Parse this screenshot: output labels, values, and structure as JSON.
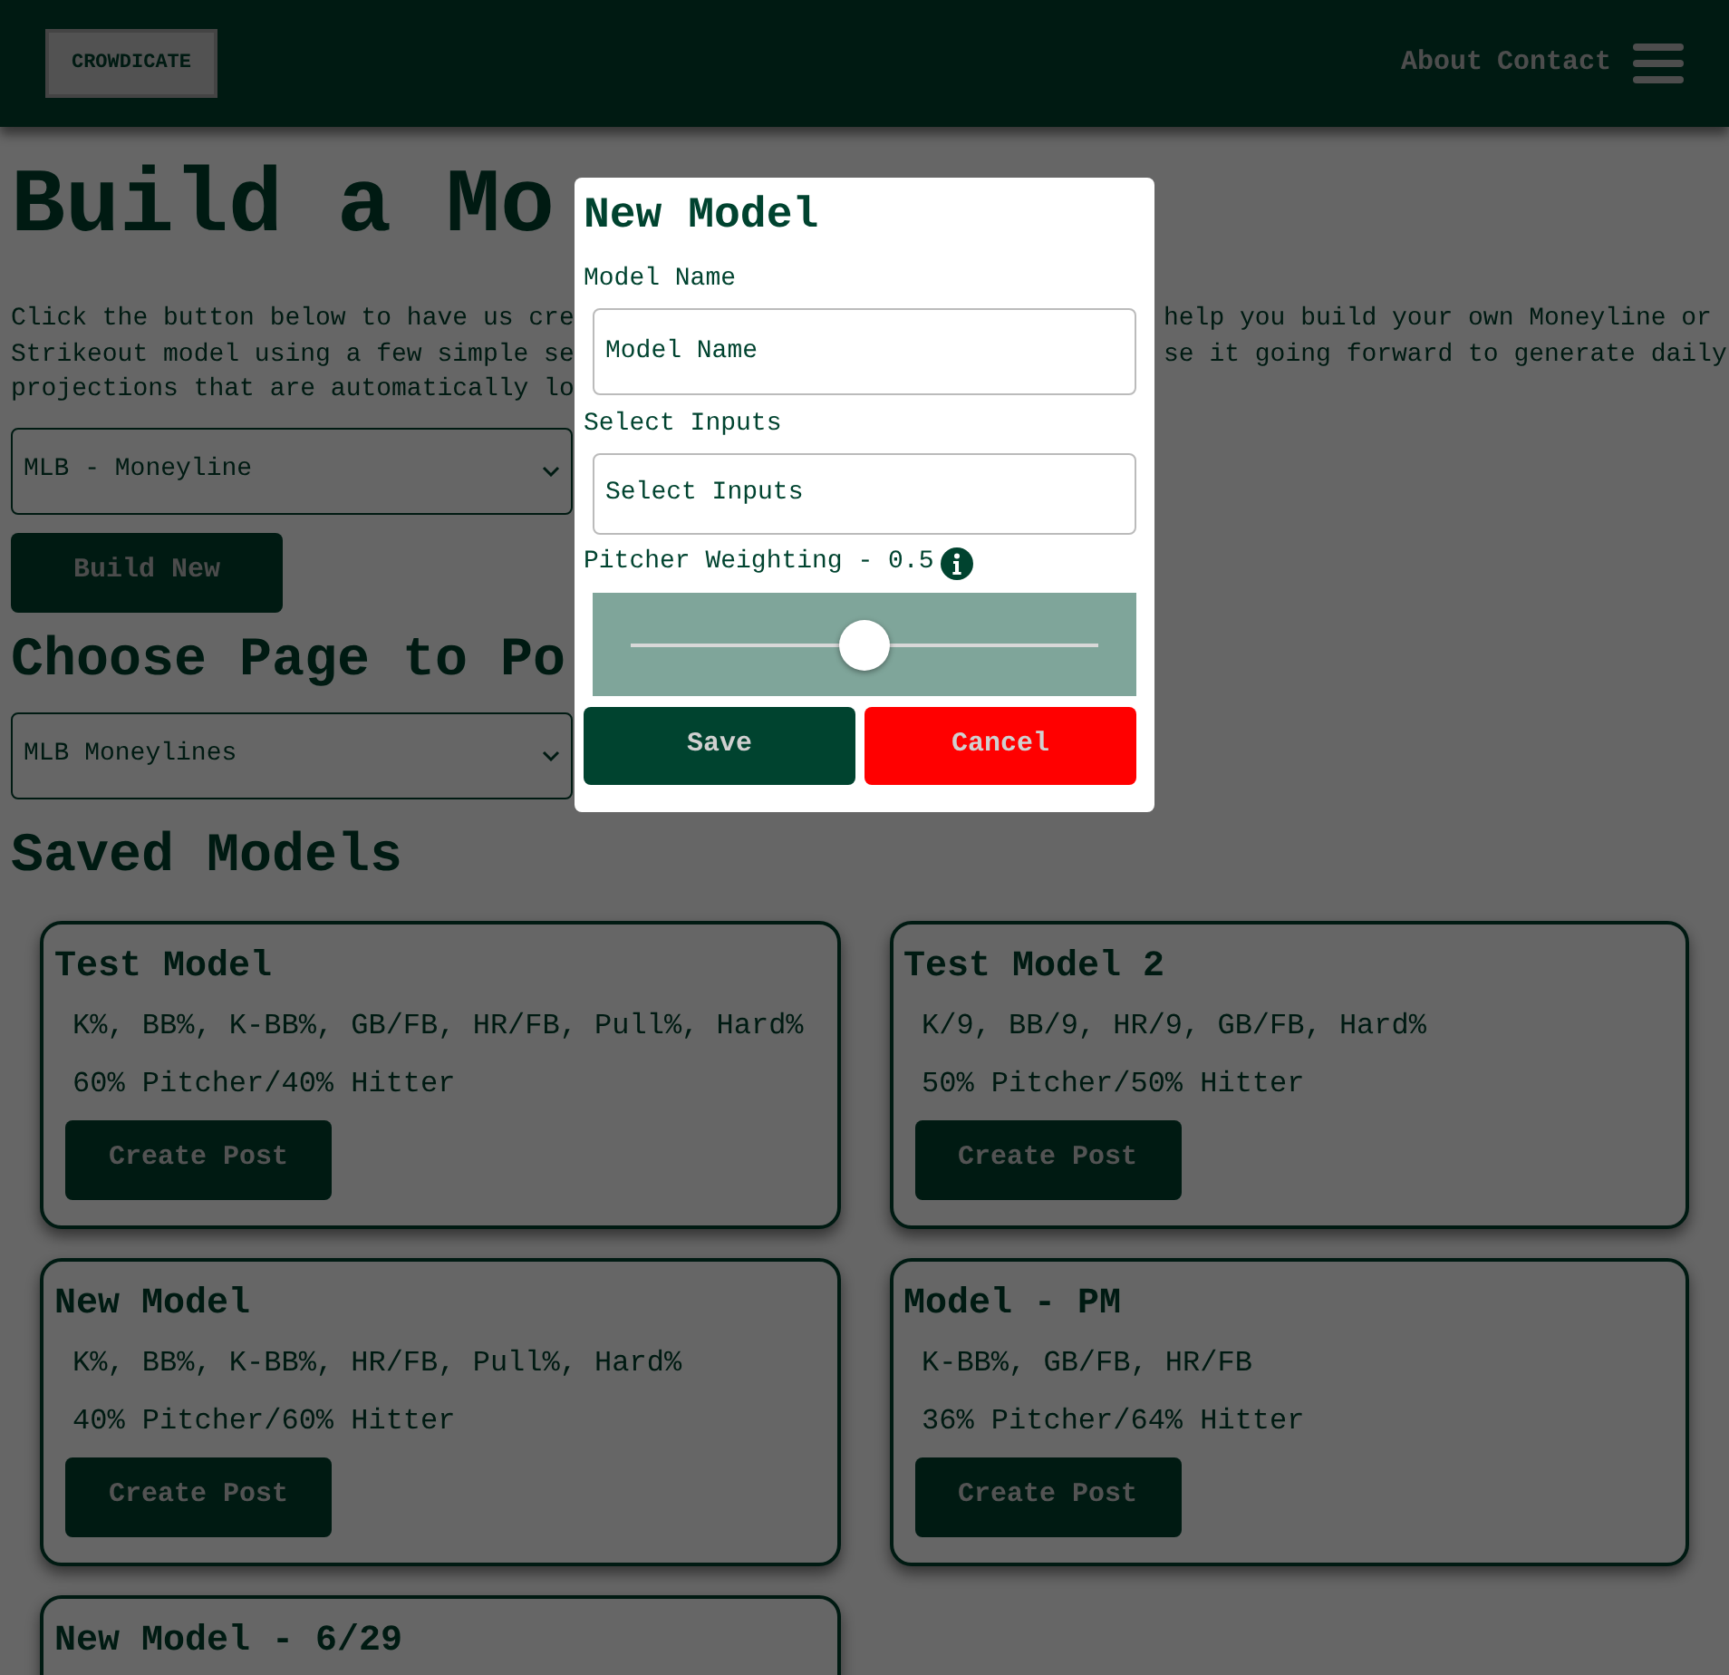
{
  "header": {
    "logo": "CROWDICATE",
    "links": [
      "About",
      "Contact"
    ]
  },
  "page": {
    "title": "Build a Mo",
    "intro_left": [
      "Click the button below to have us cre",
      "Strikeout model using a few simple se",
      "projections that are automatically lo"
    ],
    "intro_right": [
      "help you build your own Moneyline or",
      "se it going forward to generate daily"
    ],
    "model_type": "MLB - Moneyline",
    "build_button": "Build New",
    "choose_heading": "Choose Page to Po",
    "page_select": "MLB Moneylines",
    "saved_heading": "Saved Models"
  },
  "models": [
    {
      "name": "Test Model",
      "inputs": "K%, BB%, K-BB%, GB/FB, HR/FB, Pull%, Hard%",
      "weighting": "60% Pitcher/40% Hitter",
      "button": "Create Post"
    },
    {
      "name": "Test Model 2",
      "inputs": "K/9, BB/9, HR/9, GB/FB, Hard%",
      "weighting": "50% Pitcher/50% Hitter",
      "button": "Create Post"
    },
    {
      "name": "New Model",
      "inputs": "K%, BB%, K-BB%, HR/FB, Pull%, Hard%",
      "weighting": "40% Pitcher/60% Hitter",
      "button": "Create Post"
    },
    {
      "name": "Model - PM",
      "inputs": "K-BB%, GB/FB, HR/FB",
      "weighting": "36% Pitcher/64% Hitter",
      "button": "Create Post"
    },
    {
      "name": "New Model - 6/29"
    }
  ],
  "dialog": {
    "title": "New Model",
    "name_label": "Model Name",
    "name_placeholder": "Model Name",
    "inputs_label": "Select Inputs",
    "inputs_placeholder": "Select Inputs",
    "weighting_label": "Pitcher Weighting - 0.5",
    "level": 0.5,
    "save": "Save",
    "cancel": "Cancel"
  }
}
